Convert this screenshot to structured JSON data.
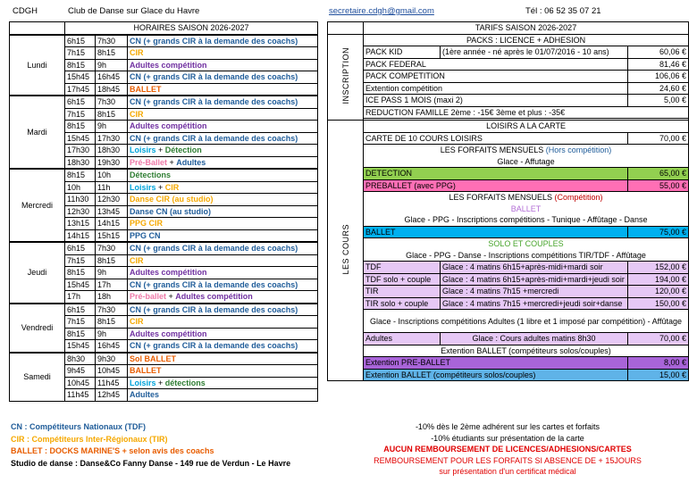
{
  "header": {
    "org": "CDGH",
    "club": "Club de Danse sur Glace du Havre",
    "email": "secretaire.cdgh@gmail.com",
    "phone": "Tél : 06 52 35 07 21"
  },
  "schedule": {
    "title": "HORAIRES SAISON 2026-2027",
    "days": [
      {
        "name": "Lundi",
        "rows": [
          {
            "start": "6h15",
            "end": "7h30",
            "parts": [
              {
                "t": "CN (+ grands CIR à la demande des coachs)",
                "c": "tdf"
              }
            ]
          },
          {
            "start": "7h15",
            "end": "8h15",
            "parts": [
              {
                "t": "CIR",
                "c": "cir"
              }
            ]
          },
          {
            "start": "8h15",
            "end": "9h",
            "parts": [
              {
                "t": "Adultes compétition",
                "c": "adu"
              }
            ]
          },
          {
            "start": "15h45",
            "end": "16h45",
            "parts": [
              {
                "t": "CN (+ grands CIR à la demande des coachs)",
                "c": "tdf"
              }
            ]
          },
          {
            "start": "17h45",
            "end": "18h45",
            "parts": [
              {
                "t": "BALLET",
                "c": "bal"
              }
            ]
          }
        ]
      },
      {
        "name": "Mardi",
        "rows": [
          {
            "start": "6h15",
            "end": "7h30",
            "parts": [
              {
                "t": "CN (+ grands CIR à la demande des coachs)",
                "c": "tdf"
              }
            ]
          },
          {
            "start": "7h15",
            "end": "8h15",
            "parts": [
              {
                "t": "CIR",
                "c": "cir"
              }
            ]
          },
          {
            "start": "8h15",
            "end": "9h",
            "parts": [
              {
                "t": "Adultes compétition",
                "c": "adu"
              }
            ]
          },
          {
            "start": "15h45",
            "end": "17h30",
            "parts": [
              {
                "t": "CN (+ grands CIR à la demande des coachs)",
                "c": "tdf"
              }
            ]
          },
          {
            "start": "17h30",
            "end": "18h30",
            "parts": [
              {
                "t": "Loisirs",
                "c": "loi"
              },
              {
                "t": " + ",
                "c": "plain"
              },
              {
                "t": "Détection",
                "c": "det"
              }
            ]
          },
          {
            "start": "18h30",
            "end": "19h30",
            "parts": [
              {
                "t": "Pré-Ballet",
                "c": "pb"
              },
              {
                "t": " + ",
                "c": "plain"
              },
              {
                "t": "Adultes",
                "c": "tdf"
              }
            ]
          }
        ]
      },
      {
        "name": "Mercredi",
        "rows": [
          {
            "start": "8h15",
            "end": "10h",
            "parts": [
              {
                "t": "Détections",
                "c": "det"
              }
            ]
          },
          {
            "start": "10h",
            "end": "11h",
            "parts": [
              {
                "t": "Loisirs",
                "c": "loi"
              },
              {
                "t": " + ",
                "c": "plain"
              },
              {
                "t": "CIR",
                "c": "cir"
              }
            ]
          },
          {
            "start": "11h30",
            "end": "12h30",
            "parts": [
              {
                "t": "Danse CIR (au studio)",
                "c": "cir"
              }
            ]
          },
          {
            "start": "12h30",
            "end": "13h45",
            "parts": [
              {
                "t": "Danse CN (au studio)",
                "c": "tdf"
              }
            ]
          },
          {
            "start": "13h15",
            "end": "14h15",
            "parts": [
              {
                "t": "PPG CIR",
                "c": "cir"
              }
            ]
          },
          {
            "start": "14h15",
            "end": "15h15",
            "parts": [
              {
                "t": "PPG CN",
                "c": "tdf"
              }
            ]
          }
        ]
      },
      {
        "name": "Jeudi",
        "rows": [
          {
            "start": "6h15",
            "end": "7h30",
            "parts": [
              {
                "t": "CN (+ grands CIR à la demande des coachs)",
                "c": "tdf"
              }
            ]
          },
          {
            "start": "7h15",
            "end": "8h15",
            "parts": [
              {
                "t": "CIR",
                "c": "cir"
              }
            ]
          },
          {
            "start": "8h15",
            "end": "9h",
            "parts": [
              {
                "t": "Adultes compétition",
                "c": "adu"
              }
            ]
          },
          {
            "start": "15h45",
            "end": "17h",
            "parts": [
              {
                "t": "CN (+ grands CIR à la demande des coachs)",
                "c": "tdf"
              }
            ]
          },
          {
            "start": "17h",
            "end": "18h",
            "parts": [
              {
                "t": "Pré-ballet",
                "c": "pb"
              },
              {
                "t": " + ",
                "c": "plain"
              },
              {
                "t": "Adultes compétition",
                "c": "adu"
              }
            ]
          }
        ]
      },
      {
        "name": "Vendredi",
        "rows": [
          {
            "start": "6h15",
            "end": "7h30",
            "parts": [
              {
                "t": "CN (+ grands CIR à la demande des coachs)",
                "c": "tdf"
              }
            ]
          },
          {
            "start": "7h15",
            "end": "8h15",
            "parts": [
              {
                "t": "CIR",
                "c": "cir"
              }
            ]
          },
          {
            "start": "8h15",
            "end": "9h",
            "parts": [
              {
                "t": "Adultes compétition",
                "c": "adu"
              }
            ]
          },
          {
            "start": "15h45",
            "end": "16h45",
            "parts": [
              {
                "t": "CN (+ grands CIR à la demande des coachs)",
                "c": "tdf"
              }
            ]
          }
        ]
      },
      {
        "name": "Samedi",
        "rows": [
          {
            "start": "8h30",
            "end": "9h30",
            "parts": [
              {
                "t": "Sol BALLET",
                "c": "bal"
              }
            ]
          },
          {
            "start": "9h45",
            "end": "10h45",
            "parts": [
              {
                "t": "BALLET",
                "c": "bal"
              }
            ]
          },
          {
            "start": "10h45",
            "end": "11h45",
            "parts": [
              {
                "t": "Loisirs",
                "c": "loi"
              },
              {
                "t": " + ",
                "c": "plain"
              },
              {
                "t": "détections",
                "c": "det"
              }
            ]
          },
          {
            "start": "11h45",
            "end": "12h45",
            "parts": [
              {
                "t": "Adultes",
                "c": "tdf"
              }
            ]
          }
        ]
      }
    ]
  },
  "tarifs": {
    "title": "TARIFS SAISON 2026-2027",
    "inscription_label": "INSCRIPTION",
    "cours_label": "LES COURS",
    "packs_header": "PACKS : LICENCE + ADHESION",
    "packs": [
      {
        "name": "PACK KID",
        "detail": "(1ère année - né après le 01/07/2016 - 10 ans)",
        "price": "60,06 €"
      },
      {
        "name": "PACK FEDERAL",
        "detail": "",
        "price": "81,46 €"
      },
      {
        "name": "PACK COMPETITION",
        "detail": "",
        "price": "106,06 €"
      },
      {
        "name": "Extention compétition",
        "detail": "",
        "price": "24,60 €"
      },
      {
        "name": "ICE PASS 1 MOIS (maxi 2)",
        "detail": "",
        "price": "5,00 €"
      }
    ],
    "reduction": "REDUCTION FAMILLE   2ème : -15€   3ème et plus : -35€",
    "loisirs_header": "LOISIRS A LA CARTE",
    "carte10": {
      "name": "CARTE DE 10 COURS LOISIRS",
      "price": "70,00 €"
    },
    "forfaits_hc_title": "LES FORFAITS MENSUELS",
    "forfaits_hc_sub": "(Hors compétition)",
    "forfaits_hc_desc": "Glace - Affutage",
    "detection": {
      "name": "DETECTION",
      "price": "65,00 €"
    },
    "preballet": {
      "name": "PREBALLET (avec PPG)",
      "price": "55,00 €"
    },
    "forfaits_c_title": "LES FORFAITS MENSUELS",
    "forfaits_c_sub": "(Compétition)",
    "ballet_title": "BALLET",
    "ballet_desc": "Glace - PPG - Inscriptions compétitions - Tunique - Affûtage - Danse",
    "ballet": {
      "name": "BALLET",
      "price": "75,00 €"
    },
    "solo_title": "SOLO ET COUPLES",
    "solo_desc": "Glace - PPG - Danse - Inscriptions compétitions TIR/TDF - Affûtage",
    "solo_rows": [
      {
        "name": "TDF",
        "detail": "Glace : 4 matins 6h15+après-midi+mardi soir",
        "price": "152,00 €"
      },
      {
        "name": "TDF solo + couple",
        "detail": "Glace : 4 matins 6h15+après-midi+mardi+jeudi soir",
        "price": "194,00 €"
      },
      {
        "name": "TIR",
        "detail": "Glace : 4 matins 7h15 +mercredi",
        "price": "120,00 €"
      },
      {
        "name": "TIR solo + couple",
        "detail": "Glace : 4 matins 7h15 +mercredi+jeudi soir+danse",
        "price": "150,00 €"
      }
    ],
    "adultes_desc": "Glace - Inscriptions compétitions Adultes (1 libre et 1 imposé par compétition) - Affûtage",
    "adultes": {
      "name": "Adultes",
      "detail": "Glace : Cours adultes matins 8h30",
      "price": "70,00 €"
    },
    "extension_header": "Extention BALLET (compétiteurs solos/couples)",
    "ext_preballet": {
      "name": "Extention PRE-BALLET",
      "price": "8,00 €"
    },
    "ext_ballet": {
      "name": "Extention BALLET (compétiteurs solos/couples)",
      "price": "15,00 €"
    }
  },
  "legend": [
    {
      "text": "CN : Compétiteurs Nationaux (TDF)",
      "c": "tdf"
    },
    {
      "text": "CIR : Compétiteurs Inter-Régionaux (TIR)",
      "c": "cir"
    },
    {
      "text": "BALLET : DOCKS MARINE'S + selon avis des coachs",
      "c": "bal"
    },
    {
      "text": "Studio de danse : Danse&Co Fanny Danse - 149 rue de Verdun - Le Havre",
      "c": "blk"
    }
  ],
  "notes": [
    {
      "text": "-10% dès le 2ème adhérent sur les cartes et forfaits",
      "c": "plain"
    },
    {
      "text": "-10% étudiants sur présentation de la carte",
      "c": "plain"
    },
    {
      "text": "AUCUN REMBOURSEMENT DE LICENCES/ADHESIONS/CARTES",
      "c": "bold-red"
    },
    {
      "text": "REMBOURSEMENT POUR LES FORFAITS SI ABSENCE DE + 15JOURS",
      "c": "red"
    },
    {
      "text": "sur présentation d'un certificat médical",
      "c": "red"
    }
  ]
}
